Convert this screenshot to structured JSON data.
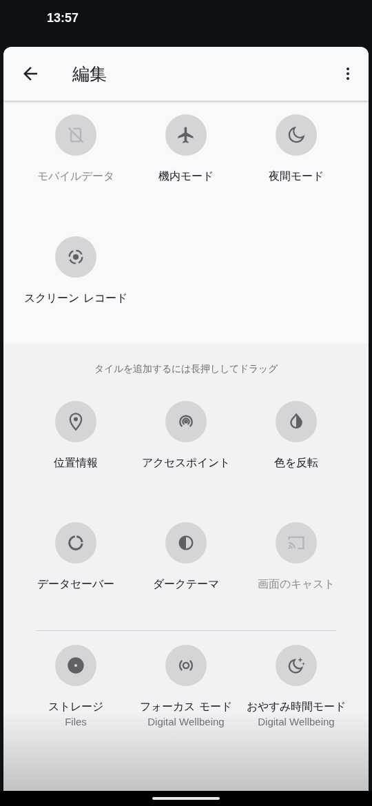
{
  "status_bar": {
    "time": "13:57"
  },
  "header": {
    "title": "編集"
  },
  "active_tiles": [
    {
      "label": "モバイルデータ",
      "disabled": true
    },
    {
      "label": "機内モード",
      "disabled": false
    },
    {
      "label": "夜間モード",
      "disabled": false
    },
    {
      "label": "スクリーン レコード",
      "disabled": false
    }
  ],
  "available": {
    "hint": "タイルを追加するには長押ししてドラッグ",
    "tiles": [
      {
        "label": "位置情報",
        "disabled": false
      },
      {
        "label": "アクセスポイント",
        "disabled": false
      },
      {
        "label": "色を反転",
        "disabled": false
      },
      {
        "label": "データセーバー",
        "disabled": false
      },
      {
        "label": "ダークテーマ",
        "disabled": false
      },
      {
        "label": "画面のキャスト",
        "disabled": true
      }
    ],
    "app_tiles": [
      {
        "label": "ストレージ",
        "subtitle": "Files",
        "disabled": false
      },
      {
        "label": "フォーカス モード",
        "subtitle": "Digital Wellbeing",
        "disabled": false
      },
      {
        "label": "おやすみ時間モード",
        "subtitle": "Digital Wellbeing",
        "disabled": false
      }
    ]
  }
}
